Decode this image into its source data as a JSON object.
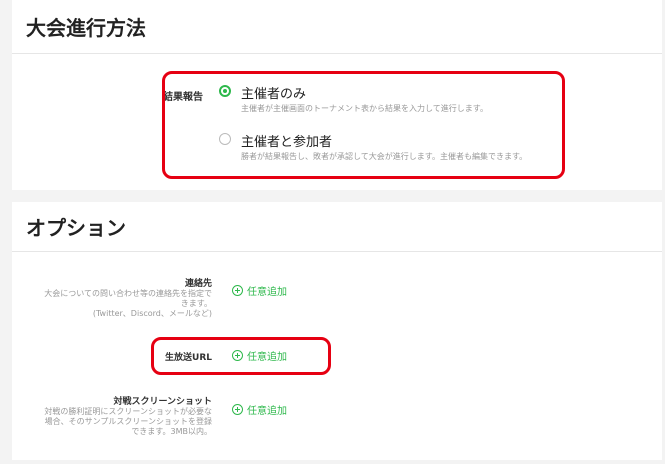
{
  "sections": {
    "progress": {
      "title": "大会進行方法",
      "result_label": "結果報告",
      "options": [
        {
          "title": "主催者のみ",
          "desc": "主催者が主催画面のトーナメント表から結果を入力して進行します。",
          "selected": true
        },
        {
          "title": "主催者と参加者",
          "desc": "勝者が結果報告し、敗者が承認して大会が進行します。主催者も編集できます。",
          "selected": false
        }
      ]
    },
    "options": {
      "title": "オプション",
      "rows": [
        {
          "label": "連絡先",
          "hint": [
            "大会についての問い合わせ等の連絡先を指定で",
            "きます。",
            "(Twitter、Discord、メールなど)"
          ],
          "action": "任意追加"
        },
        {
          "label": "生放送URL",
          "action": "任意追加"
        },
        {
          "label": "対戦スクリーンショット",
          "hint": [
            "対戦の勝利証明にスクリーンショットが必要な",
            "場合、そのサンプルスクリーンショットを登録",
            "できます。3MB以内。"
          ],
          "action": "任意追加"
        }
      ]
    }
  },
  "colors": {
    "accent": "#2eb84c",
    "highlight": "#e60012"
  }
}
